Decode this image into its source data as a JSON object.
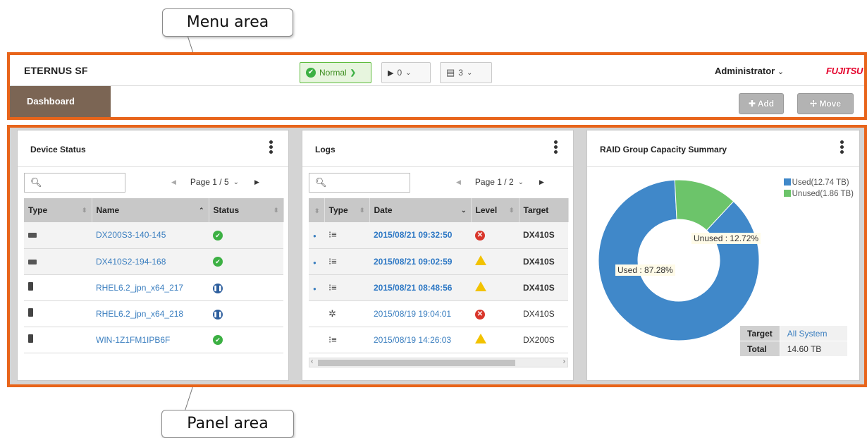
{
  "annotations": {
    "menu_area": "Menu area",
    "panel_area": "Panel area"
  },
  "menubar": {
    "brand": "ETERNUS SF",
    "status_normal": "Normal",
    "running_count": "0",
    "message_count": "3",
    "user": "Administrator",
    "logo": "FUJITSU"
  },
  "tabbar": {
    "tab_dashboard": "Dashboard",
    "add_label": "Add",
    "move_label": "Move"
  },
  "device_status": {
    "title": "Device Status",
    "page": "Page 1 / 5",
    "columns": [
      "Type",
      "Name",
      "Status"
    ],
    "rows": [
      {
        "type": "storage",
        "name": "DX200S3-140-145",
        "status": "ok"
      },
      {
        "type": "storage",
        "name": "DX410S2-194-168",
        "status": "ok"
      },
      {
        "type": "server",
        "name": "RHEL6.2_jpn_x64_217",
        "status": "paused"
      },
      {
        "type": "server",
        "name": "RHEL6.2_jpn_x64_218",
        "status": "paused"
      },
      {
        "type": "server",
        "name": "WIN-1Z1FM1IPB6F",
        "status": "ok"
      }
    ]
  },
  "logs": {
    "title": "Logs",
    "page": "Page 1 / 2",
    "columns": [
      "Type",
      "Date",
      "Level",
      "Target"
    ],
    "rows": [
      {
        "unread": true,
        "type": "list",
        "date": "2015/08/21 09:32:50",
        "level": "error",
        "target": "DX410S"
      },
      {
        "unread": true,
        "type": "list",
        "date": "2015/08/21 09:02:59",
        "level": "warning",
        "target": "DX410S"
      },
      {
        "unread": true,
        "type": "list",
        "date": "2015/08/21 08:48:56",
        "level": "warning",
        "target": "DX410S"
      },
      {
        "unread": false,
        "type": "gear",
        "date": "2015/08/19 19:04:01",
        "level": "error",
        "target": "DX410S"
      },
      {
        "unread": false,
        "type": "list",
        "date": "2015/08/19 14:26:03",
        "level": "warning",
        "target": "DX200S"
      }
    ]
  },
  "raid": {
    "title": "RAID Group Capacity Summary",
    "legend_used": "Used(12.74 TB)",
    "legend_unused": "Unused(1.86 TB)",
    "label_used": "Used : 87.28%",
    "label_unused": "Unused : 12.72%",
    "target_key": "Target",
    "target_value": "All System",
    "total_key": "Total",
    "total_value": "14.60 TB",
    "colors": {
      "used": "#4088c9",
      "unused": "#6cc46a"
    }
  },
  "chart_data": {
    "type": "pie",
    "categories": [
      "Used",
      "Unused"
    ],
    "values": [
      87.28,
      12.72
    ],
    "title": "RAID Group Capacity Summary",
    "capacity_tb": [
      12.74,
      1.86
    ]
  }
}
